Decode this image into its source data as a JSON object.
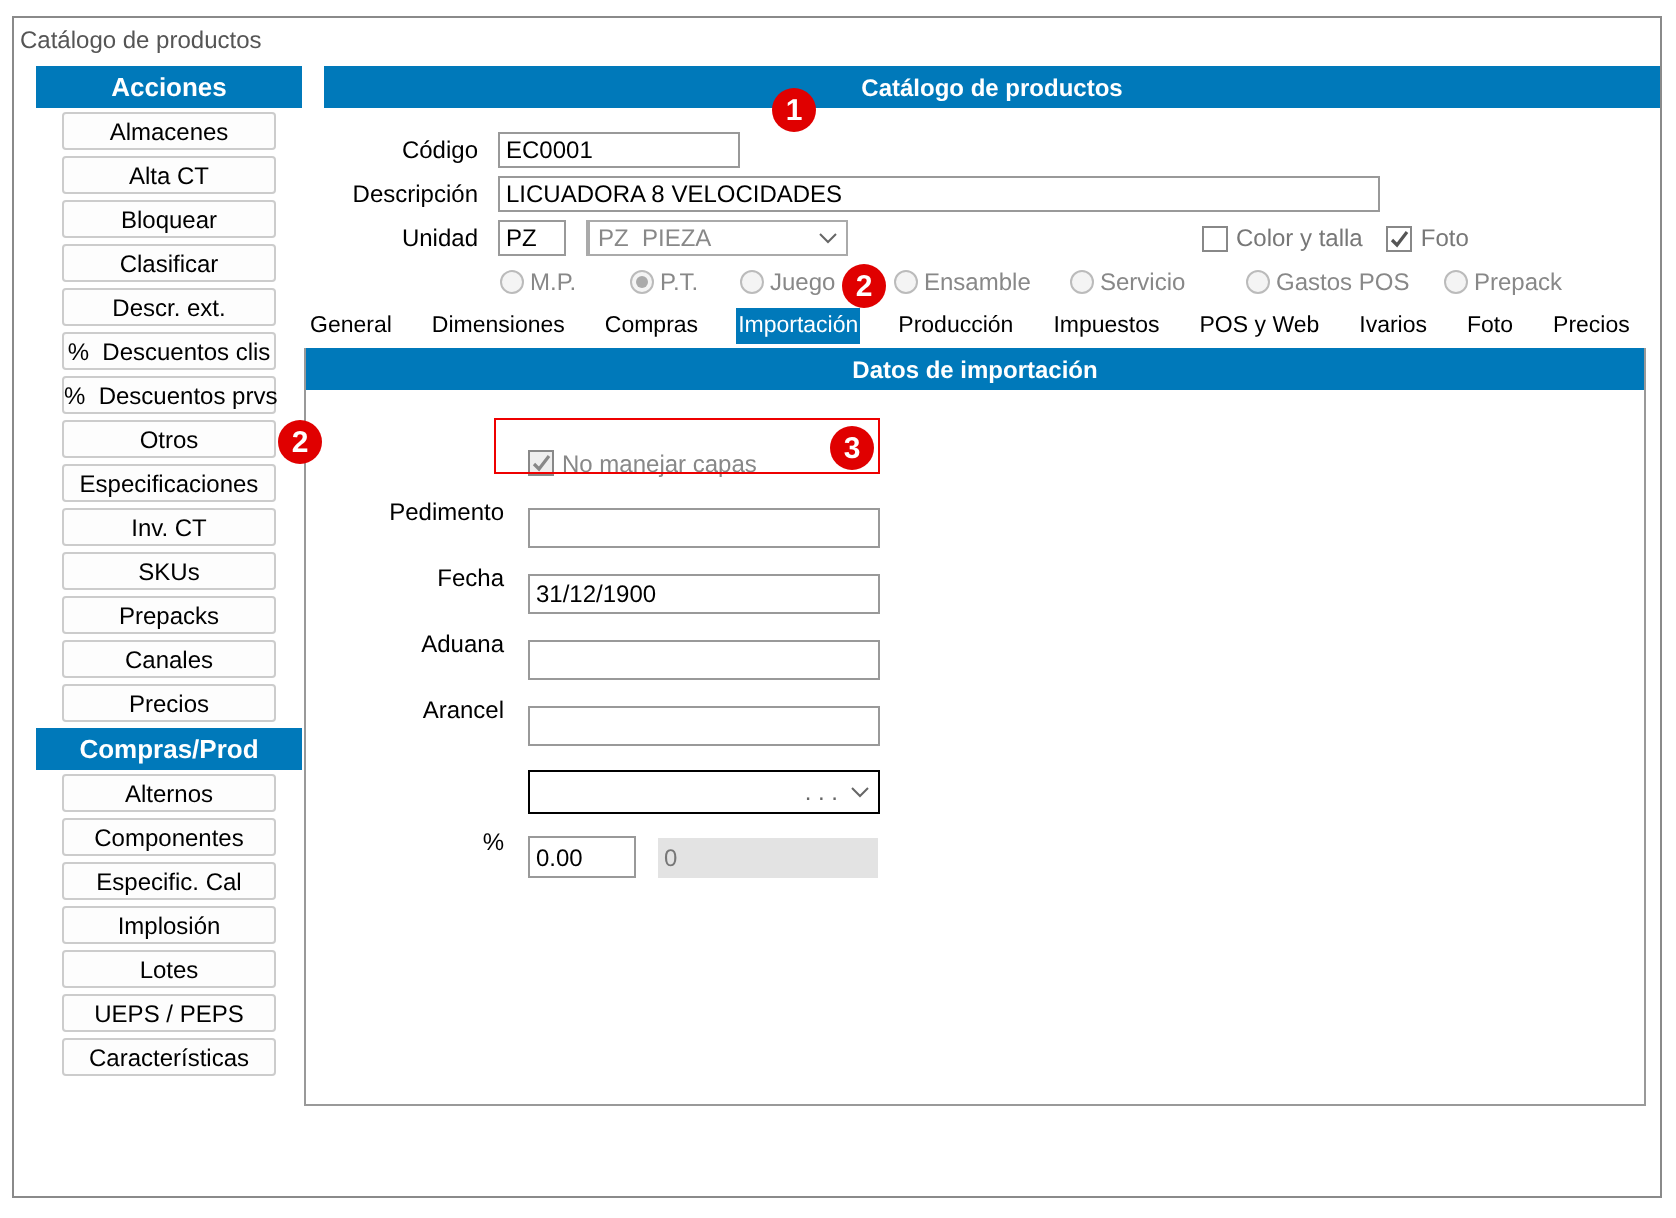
{
  "window": {
    "title": "Catálogo de productos"
  },
  "sidebar": {
    "sections": [
      {
        "title": "Acciones",
        "items": [
          "Almacenes",
          "Alta CT",
          "Bloquear",
          "Clasificar",
          "Descr. ext.",
          "%  Descuentos clis",
          "%  Descuentos prvs",
          "Otros",
          "Especificaciones",
          "Inv. CT",
          "SKUs",
          "Prepacks",
          "Canales",
          "Precios"
        ]
      },
      {
        "title": "Compras/Prod",
        "items": [
          "Alternos",
          "Componentes",
          "Especific. Cal",
          "Implosión",
          "Lotes",
          "UEPS / PEPS",
          "Características"
        ]
      }
    ]
  },
  "panel": {
    "title": "Catálogo de productos",
    "fields": [
      {
        "label": "Código",
        "value": "EC0001",
        "kind": "short"
      },
      {
        "label": "Descripción",
        "value": "LICUADORA 8 VELOCIDADES",
        "kind": "long"
      }
    ],
    "unit": {
      "label": "Unidad",
      "code": "PZ",
      "select": "PZ  PIEZA"
    },
    "checkboxes": [
      {
        "label": "Color y talla",
        "checked": false
      },
      {
        "label": "Foto",
        "checked": true
      }
    ],
    "types": [
      {
        "label": "M.P.",
        "selected": false
      },
      {
        "label": "P.T.",
        "selected": true
      },
      {
        "label": "Juego",
        "selected": false
      },
      {
        "label": "Ensamble",
        "selected": false
      },
      {
        "label": "Servicio",
        "selected": false
      },
      {
        "label": "Gastos POS",
        "selected": false
      },
      {
        "label": "Prepack",
        "selected": false
      }
    ],
    "tabs": [
      {
        "label": "General",
        "selected": false
      },
      {
        "label": "Dimensiones",
        "selected": false
      },
      {
        "label": "Compras",
        "selected": false
      },
      {
        "label": "Importación",
        "selected": true
      },
      {
        "label": "Producción",
        "selected": false
      },
      {
        "label": "Impuestos",
        "selected": false
      },
      {
        "label": "POS y Web",
        "selected": false
      },
      {
        "label": "Ivarios",
        "selected": false
      },
      {
        "label": "Foto",
        "selected": false
      },
      {
        "label": "Precios",
        "selected": false
      }
    ],
    "section": {
      "title": "Datos de importación",
      "option": {
        "label": "No manejar capas",
        "checked": true,
        "disabled": true
      },
      "fields": [
        {
          "label": "Pedimento"
        },
        {
          "label": "Fecha",
          "value": "31/12/1900"
        },
        {
          "label": "Aduana"
        },
        {
          "label": "Arancel"
        }
      ],
      "select": {
        "value": ". . ."
      },
      "percent": {
        "label": "%",
        "value": "0.00",
        "amount": "0"
      }
    }
  },
  "callouts": [
    {
      "number": "1"
    },
    {
      "number": "2"
    },
    {
      "number": "2"
    },
    {
      "number": "3"
    }
  ]
}
